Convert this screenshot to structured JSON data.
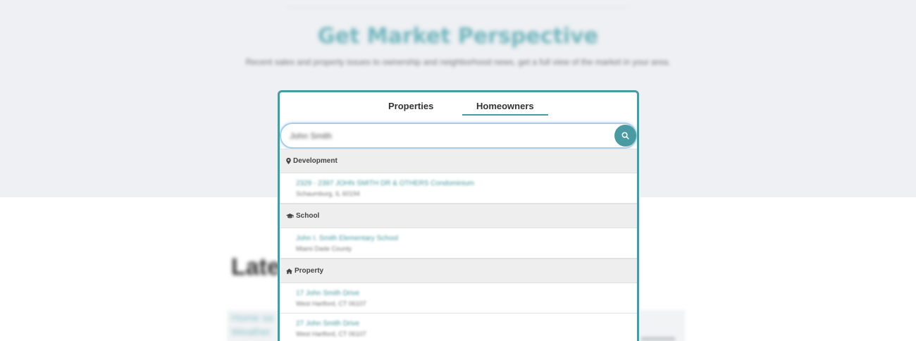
{
  "background": {
    "title": "Get Market Perspective",
    "subtitle": "Recent sales and property issues to ownership and neighborhood news, get a full view of the market in your area.",
    "latest_heading": "Latest",
    "card_text_line1": "Home sa",
    "card_text_line2": "Weather"
  },
  "tabs": [
    {
      "label": "Properties",
      "active": false
    },
    {
      "label": "Homeowners",
      "active": true
    }
  ],
  "search": {
    "value": "John Smith",
    "button_icon": "search-icon"
  },
  "groups": [
    {
      "label": "Development",
      "icon": "map-marker-icon",
      "items": [
        {
          "title": "2329 - 2397 JOHN SMITH DR & OTHERS Condominium",
          "subtitle": "Schaumburg, IL 60194"
        }
      ]
    },
    {
      "label": "School",
      "icon": "graduation-cap-icon",
      "items": [
        {
          "title": "John I. Smith Elementary School",
          "subtitle": "Miami Dade County"
        }
      ]
    },
    {
      "label": "Property",
      "icon": "home-icon",
      "items": [
        {
          "title": "17 John Smith Drive",
          "subtitle": "West Hartford, CT 06107"
        },
        {
          "title": "27 John Smith Drive",
          "subtitle": "West Hartford, CT 06107"
        }
      ]
    }
  ],
  "colors": {
    "accent": "#4a9aa1",
    "hero_bg": "#eef0f3",
    "group_bg": "#eeeeee"
  }
}
